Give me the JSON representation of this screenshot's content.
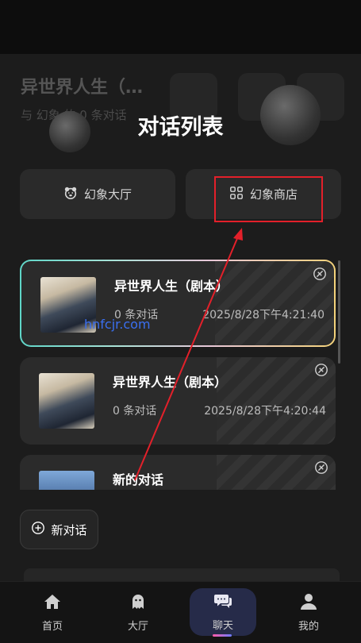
{
  "background": {
    "title": "异世界人生（…",
    "subtitle": "与 幻象 的 0 条对话"
  },
  "panel": {
    "title": "对话列表",
    "hall_button": "幻象大厅",
    "shop_button": "幻象商店"
  },
  "conversations": [
    {
      "title": "异世界人生（剧本）",
      "count": "0 条对话",
      "time": "2025/8/28下午4:21:40",
      "active": true
    },
    {
      "title": "异世界人生（剧本）",
      "count": "0 条对话",
      "time": "2025/8/28下午4:20:44",
      "active": false
    },
    {
      "title": "新的对话",
      "count": "",
      "time": "",
      "active": false
    }
  ],
  "watermark": "hnfcjr.com",
  "new_chat_label": "新对话",
  "nav": {
    "home": "首页",
    "hall": "大厅",
    "chat": "聊天",
    "mine": "我的"
  },
  "colors": {
    "highlight": "#e3202a",
    "accent_nav": "#262b49"
  }
}
